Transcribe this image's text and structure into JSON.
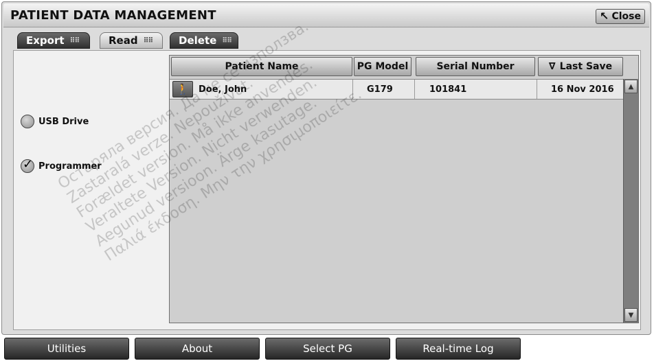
{
  "window": {
    "title": "PATIENT DATA MANAGEMENT",
    "close_label": "Close"
  },
  "tabs": [
    {
      "label": "Export",
      "state": "inactive"
    },
    {
      "label": "Read",
      "state": "active"
    },
    {
      "label": "Delete",
      "state": "inactive"
    }
  ],
  "sources": [
    {
      "label": "USB Drive",
      "checked": false
    },
    {
      "label": "Programmer",
      "checked": true
    }
  ],
  "table": {
    "columns": [
      "Patient Name",
      "PG Model",
      "Serial Number",
      "Last Save"
    ],
    "sort_indicator": "∇",
    "rows": [
      {
        "name": "Doe, John",
        "model": "G179",
        "serial": "101841",
        "last_save": "16 Nov 2016"
      }
    ]
  },
  "bottom_buttons": [
    "Utilities",
    "About",
    "Select PG",
    "Real-time Log"
  ],
  "watermark": "Остаряла версия. Да не се използва.\nZastaralá verze. Nepoužívat.\nForældet version. Må ikke anvendes.\nVeraltete Version. Nicht verwenden.\nAegunud versioon. Ärge kasutage.\nΠαλιά έκδοση. Μην την χρησιμοποιείτε."
}
